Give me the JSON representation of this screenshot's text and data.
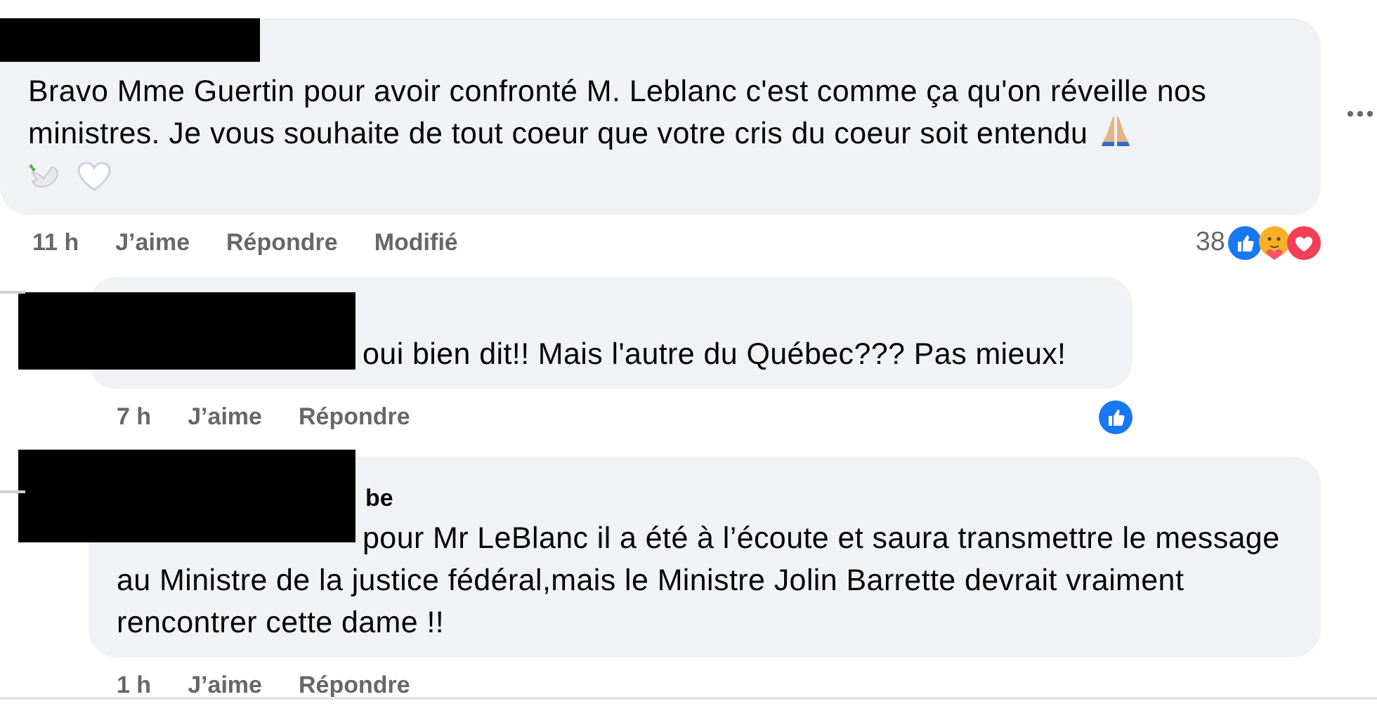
{
  "comments": [
    {
      "text": "Bravo Mme Guertin pour avoir confronté M. Leblanc c'est comme ça qu'on réveille nos ministres. Je vous souhaite de tout coeur que votre cris du coeur soit entendu",
      "emojis": [
        {
          "kind": "praying-hands"
        },
        {
          "kind": "dove"
        },
        {
          "kind": "heart"
        }
      ],
      "time": "11 h",
      "like": "J’aime",
      "reply": "Répondre",
      "edited": "Modifié",
      "reaction_count": "38",
      "reactions": [
        {
          "kind": "like"
        },
        {
          "kind": "care"
        },
        {
          "kind": "love"
        }
      ],
      "redacted": true,
      "more": true
    },
    {
      "text": "oui bien dit!! Mais l'autre du Québec??? Pas mieux!",
      "time": "7 h",
      "like": "J’aime",
      "reply": "Répondre",
      "reactions": [
        {
          "kind": "like"
        }
      ],
      "redacted": true,
      "more": false
    },
    {
      "author": "be",
      "text": "pour Mr LeBlanc il a été à l’écoute et saura transmettre le message au Ministre de la justice fédéral,mais le Ministre Jolin Barrette devrait vraiment rencontrer cette dame !!",
      "time": "1 h",
      "like": "J’aime",
      "reply": "Répondre",
      "redacted": true,
      "more": false
    }
  ]
}
